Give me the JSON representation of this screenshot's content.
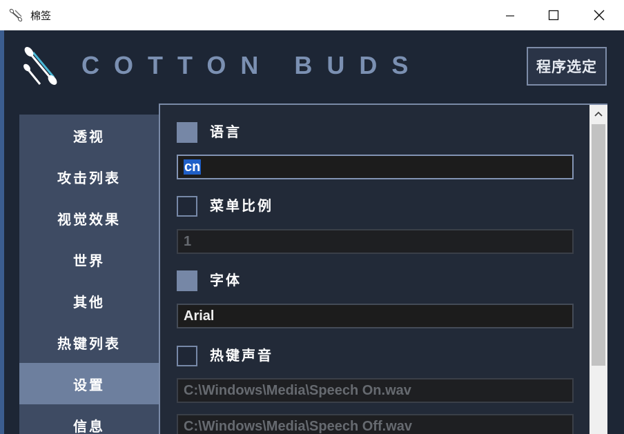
{
  "window": {
    "title": "棉签",
    "icon": "cotton-swab-icon"
  },
  "header": {
    "logo_icon": "cotton-swab-logo-icon",
    "logo_text": "COTTON BUDS",
    "select_button": "程序选定"
  },
  "sidebar": {
    "items": [
      {
        "label": "透视",
        "active": false
      },
      {
        "label": "攻击列表",
        "active": false
      },
      {
        "label": "视觉效果",
        "active": false
      },
      {
        "label": "世界",
        "active": false
      },
      {
        "label": "其他",
        "active": false
      },
      {
        "label": "热键列表",
        "active": false
      },
      {
        "label": "设置",
        "active": true
      },
      {
        "label": "信息",
        "active": false
      }
    ]
  },
  "settings": {
    "language": {
      "label": "语言",
      "checked": true,
      "value": "cn"
    },
    "menu_scale": {
      "label": "菜单比例",
      "checked": false,
      "value": "1"
    },
    "font": {
      "label": "字体",
      "checked": true,
      "value": "Arial"
    },
    "hotkey_sound": {
      "label": "热键声音",
      "checked": false,
      "on_value": "C:\\Windows\\Media\\Speech On.wav",
      "off_value": "C:\\Windows\\Media\\Speech Off.wav"
    }
  },
  "colors": {
    "accent": "#7687a6",
    "background": "#1d2635",
    "sidebar": "#3e4b63",
    "active": "#6d7f9e",
    "logo_text": "#7b90b2",
    "selection": "#1f5fc7"
  }
}
